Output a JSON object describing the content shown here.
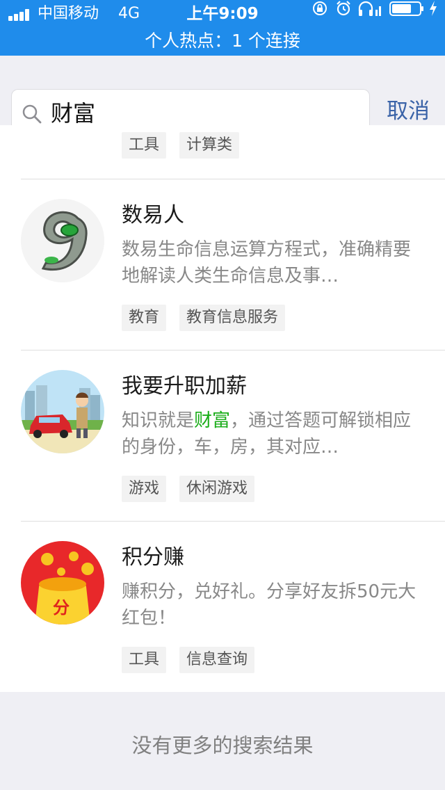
{
  "status_bar": {
    "carrier": "中国移动",
    "network": "4G",
    "time": "上午9:09",
    "hotspot": "个人热点：1 个连接"
  },
  "search": {
    "query": "财富",
    "cancel_label": "取消"
  },
  "top_partial": {
    "tags": [
      "工具",
      "计算类"
    ]
  },
  "results": [
    {
      "title": "数易人",
      "desc": "数易生命信息运算方程式，准确精要地解读人类生命信息及事…",
      "tags": [
        "教育",
        "教育信息服务"
      ],
      "icon": "green-nine-logo"
    },
    {
      "title": "我要升职加薪",
      "desc_prefix": "知识就是",
      "desc_highlight": "财富",
      "desc_suffix": "，通过答题可解锁相应的身份，车，房，其对应…",
      "tags": [
        "游戏",
        "休闲游戏"
      ],
      "icon": "car-man-cartoon"
    },
    {
      "title": "积分赚",
      "desc": "赚积分，兑好礼。分享好友拆50元大红包！",
      "tags": [
        "工具",
        "信息查询"
      ],
      "icon": "red-gold-bag",
      "icon_text": "分"
    }
  ],
  "footer": {
    "no_more": "没有更多的搜索结果"
  },
  "colors": {
    "status_bar": "#1f8ceb",
    "highlight": "#1aad19",
    "cancel": "#3a63a8"
  }
}
